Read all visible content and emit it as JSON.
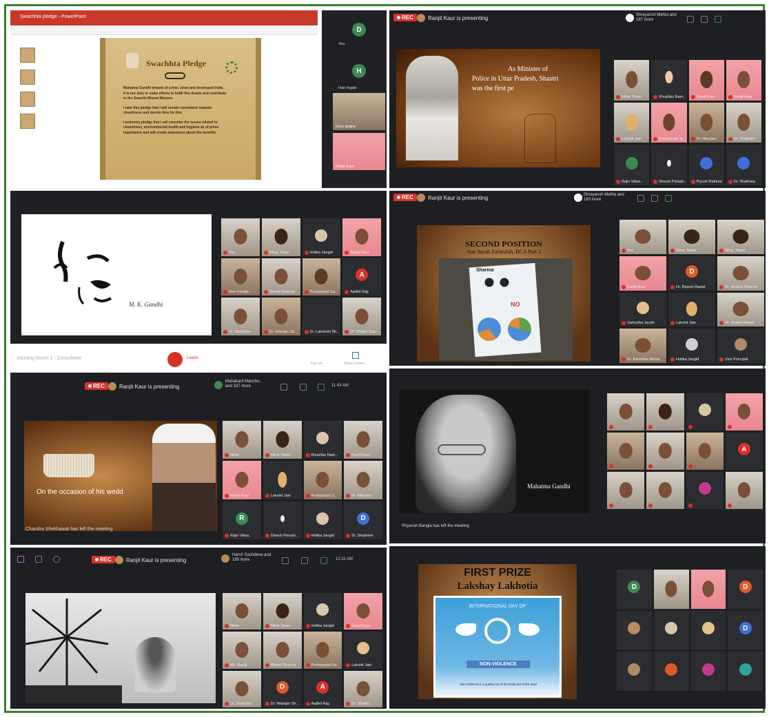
{
  "t1": {
    "window_strip": "Swachhta pledge - PowerPoint",
    "pledge_title": "Swachhta Pledge",
    "pledge_lines": [
      "Mahatma Gandhi dreamt of a free, clean and developed India.",
      "It is our duty to make efforts to fulfill this dream and contribute",
      "to the Swachh Bharat Mission.",
      "I take this pledge that I will remain committed towards",
      "cleanliness and devote time for this.",
      "I solemnly pledge that I will consider the issues related to",
      "cleanliness, environmental health and hygiene as of prime",
      "importance and will create awareness about the benefits"
    ],
    "participants": [
      {
        "initial": "D",
        "name": "You"
      },
      {
        "initial": "H",
        "name": "Hari Ingale"
      },
      {
        "name": "Guru gogna"
      },
      {
        "name": "Ranjit Kaur"
      }
    ]
  },
  "t2": {
    "rec": "REC",
    "presenting": "Ranjit Kaur is presenting",
    "viewer": "Shreyansh Mehta and 187 more",
    "slide_text": [
      "As Minister of",
      "Police in Uttar Pradesh, Shastri",
      "was the first pe"
    ],
    "participants": [
      "Nihar Tiwari",
      "Khushbu Nam..",
      "Ranjit Kaur",
      "Ranjit Kaur",
      "Lakshit Jain",
      "Pushpanjali S..",
      "Dr. Nilanjan..",
      "Dr. Shaliniee",
      "Rajiv Vikas..",
      "Dinesh Parash..",
      "Piyush Rathore",
      "Dr. Shaliniee"
    ]
  },
  "t3": {
    "signature": "M. K. Gandhi",
    "participants": [
      "You",
      "Nihar Tiwari",
      "Hritika Jangid",
      "Ranjit Kaur",
      "Avni Kanigil..",
      "Shivali Sharma",
      "Pushpanjali Sa..",
      "Aadhil Rajj",
      "Dr. Shaliniee",
      "Dr. Nilanjan Sh..",
      "Dr. Lakamini Sh..",
      "Dr. Shalini Sha.."
    ]
  },
  "t4": {
    "rec": "REC",
    "presenting": "Ranjit Kaur is presenting",
    "viewer": "Shreyansh Mehta and 183 more",
    "slide_title": "SECOND POSITION",
    "slide_sub": "Aan Surah Zafarulah, BCA Part 2",
    "drawing_texts": [
      "Sharma",
      "NO"
    ],
    "participants": [
      "You",
      "Nihar Tiwari",
      "Nihar Tiwari",
      "Ranjit Kaur",
      "Dr. Ripesh Rawal",
      "Dr. Harsha Sharma",
      "Vishrutha Jacob",
      "Lakshit Jain",
      "Dr. Shalini Rawat",
      "Dr. Kanishka Mehta",
      "Hritika Jangid",
      "Vice Principal"
    ]
  },
  "t5": {
    "top_label": "Meeting Room 1 - Zoom/Meet",
    "top_actions": [
      "Leave",
      "Turn on",
      "Share screen"
    ],
    "rec": "REC",
    "presenting": "Ranjit Kaur is presenting",
    "viewer": "Mahakant Manchu.. and 187 more",
    "time": "11:43 AM",
    "slide_caption": "On the occasion of his wedd",
    "left_note": "Chandra Shekhawat has left the meeting",
    "participants": [
      "Nihar",
      "Nihar Tiwari",
      "Khushbu Nam..",
      "Ranjit Kaur",
      "Ranjit Kaur",
      "Lakshit Jain",
      "Pushpanjali S..",
      "Dr. Nilanjan..",
      "Rajiv Vikas..",
      "Dinesh Parash..",
      "Hritika Jangid",
      "Dr. Shaliniee"
    ]
  },
  "t6": {
    "slide_caption": "Mahatma Gandhi",
    "left_note": "Priyansh Bangla has left the meeting",
    "participants": [
      "",
      "",
      "",
      "",
      "",
      "",
      "",
      "A",
      "",
      "",
      "",
      ""
    ]
  },
  "t7": {
    "rec": "REC",
    "presenting": "Ranjit Kaur is presenting",
    "viewer": "Harsh Sachdeva and 189 more",
    "time": "12:11 AM",
    "participants": [
      "Nihar",
      "Nihar Tiwari",
      "Hritika Jangid",
      "Ranjit Kaur",
      "Ms. Ranjit..",
      "Shivali Sharma",
      "Pushpanjali Sa..",
      "Lakshit Jain",
      "Dr. Shaliniee",
      "Dr. Nilanjan Sh..",
      "Aadhil Rajj",
      "Dr. Shalini.."
    ]
  },
  "t8": {
    "slide_title": "FIRST PRIZE",
    "slide_sub": "Lakshay Lakhotia",
    "poster_top": "INTERNATIONAL DAY OF",
    "poster_banner": "NON-VIOLENCE",
    "poster_quote": "Non-Violence is a quality not of the Body but of the Soul",
    "participants": [
      "D",
      "",
      "D",
      "",
      "",
      "",
      "D",
      "",
      "",
      "",
      "",
      ""
    ]
  },
  "colors": {
    "border": "#3f7d2f",
    "rec": "#d9322b",
    "meet_bg": "#1e1f22",
    "tile_bg": "#3a3c40"
  }
}
